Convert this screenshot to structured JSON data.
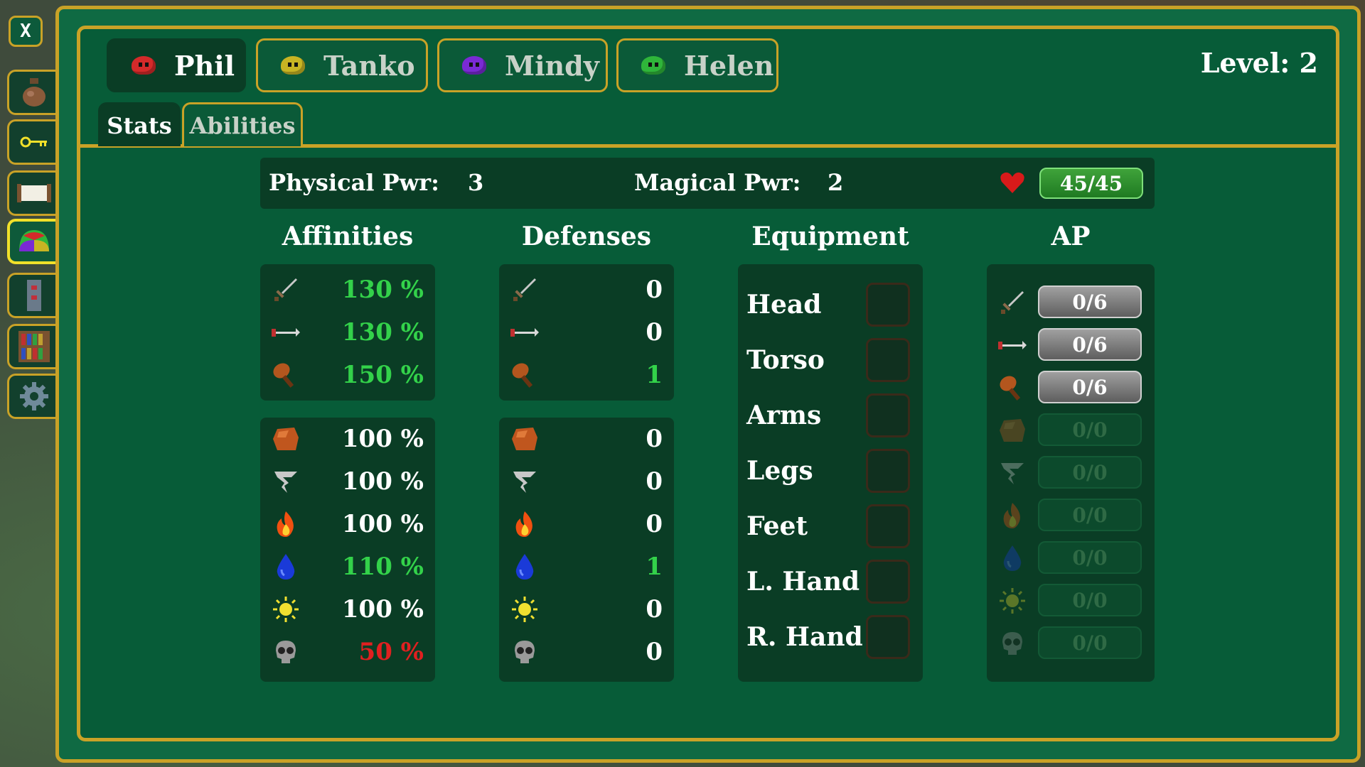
{
  "sidebar": {
    "close_label": "X",
    "items": [
      {
        "icon": "bag-icon"
      },
      {
        "icon": "key-icon"
      },
      {
        "icon": "scroll-icon"
      },
      {
        "icon": "party-slime-icon",
        "active": true
      },
      {
        "icon": "tower-icon"
      },
      {
        "icon": "bookshelf-icon"
      },
      {
        "icon": "gear-icon"
      }
    ]
  },
  "characters": [
    {
      "name": "Phil",
      "color": "#d42a2a",
      "active": true
    },
    {
      "name": "Tanko",
      "color": "#c8b423",
      "active": false
    },
    {
      "name": "Mindy",
      "color": "#7a2ad4",
      "active": false
    },
    {
      "name": "Helen",
      "color": "#2fb53a",
      "active": false
    }
  ],
  "level_label": "Level: 2",
  "subtabs": {
    "stats": "Stats",
    "abilities": "Abilities"
  },
  "power": {
    "physical_label": "Physical Pwr:",
    "physical_value": "3",
    "magical_label": "Magical Pwr:",
    "magical_value": "2",
    "hp": "45/45"
  },
  "columns": {
    "affinities": "Affinities",
    "defenses": "Defenses",
    "equipment": "Equipment",
    "ap": "AP"
  },
  "physical_types": [
    "slash",
    "pierce",
    "blunt"
  ],
  "elemental_types": [
    "earth",
    "wind",
    "fire",
    "water",
    "light",
    "dark"
  ],
  "affinities": {
    "physical": [
      "130 %",
      "130 %",
      "150 %"
    ],
    "elemental": [
      "100 %",
      "100 %",
      "100 %",
      "110 %",
      "100 %",
      "50 %"
    ],
    "physical_state": [
      "up",
      "up",
      "up"
    ],
    "elemental_state": [
      "normal",
      "normal",
      "normal",
      "up",
      "normal",
      "down"
    ]
  },
  "defenses": {
    "physical": [
      "0",
      "0",
      "1"
    ],
    "elemental": [
      "0",
      "0",
      "0",
      "1",
      "0",
      "0"
    ]
  },
  "equipment": [
    "Head",
    "Torso",
    "Arms",
    "Legs",
    "Feet",
    "L. Hand",
    "R. Hand"
  ],
  "ap": [
    "0/6",
    "0/6",
    "0/6",
    "0/0",
    "0/0",
    "0/0",
    "0/0",
    "0/0",
    "0/0"
  ],
  "colors": {
    "gold": "#c9a227",
    "panel": "#075c38",
    "dark": "#0a3d25",
    "up": "#33d24a",
    "down": "#e02020"
  }
}
